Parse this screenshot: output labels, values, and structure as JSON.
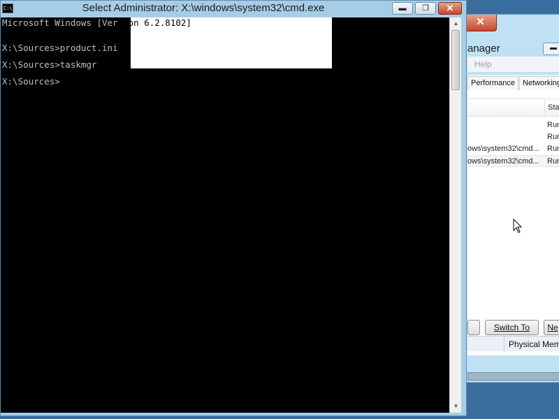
{
  "taskmgr": {
    "title_partial": "anager",
    "close_glyph": "✕",
    "min_glyph": "▬",
    "menu_help": "Help",
    "tabs": [
      "Performance",
      "Networking"
    ],
    "status_header": "Stat",
    "rows": [
      {
        "name": "",
        "status": "Run"
      },
      {
        "name": "",
        "status": "Run"
      },
      {
        "name": "ows\\system32\\cmd...",
        "status": "Run"
      },
      {
        "name": "ows\\system32\\cmd...",
        "status": "Run"
      }
    ],
    "buttons": [
      "",
      "Switch To",
      "Ne"
    ],
    "status_bar": "Physical Memo"
  },
  "cmd": {
    "icon_text": "C:\\",
    "title": "Select Administrator: X:\\windows\\system32\\cmd.exe",
    "minimize_glyph": "▬",
    "restore_glyph": "❐",
    "close_glyph": "✕",
    "lines": {
      "version_pre": "Microsoft Windows [Ver",
      "version_sel": "sion 6.2.8102]",
      "l2": "X:\\Sources>product.ini",
      "l3": "X:\\Sources>taskmgr",
      "l4": "X:\\Sources>"
    },
    "scroll_up": "▲",
    "scroll_down": "▼"
  }
}
